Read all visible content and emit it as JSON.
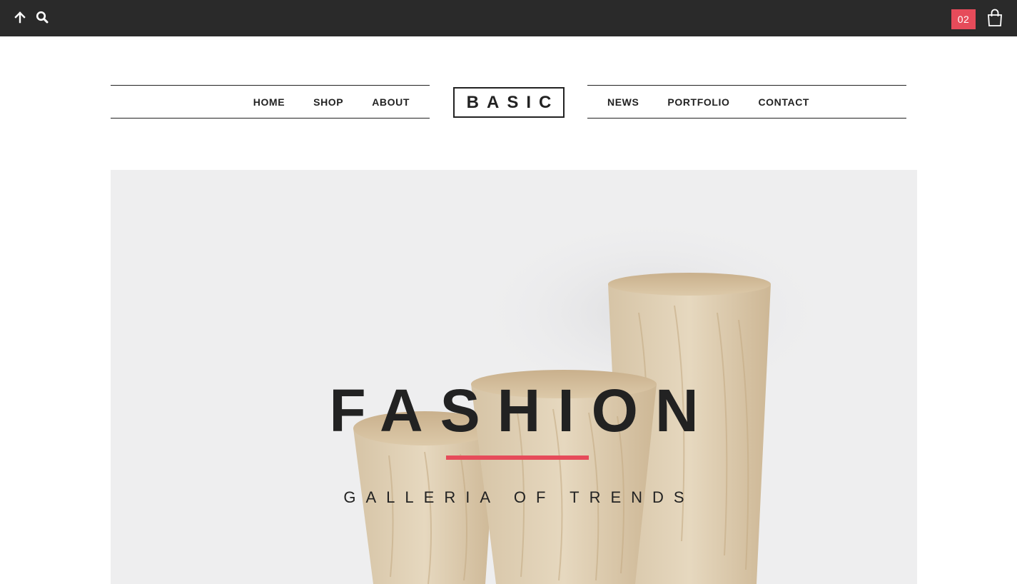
{
  "topbar": {
    "cart_count": "02",
    "icons": [
      "arrow-up-icon",
      "search-icon",
      "shopping-bag-icon"
    ],
    "background": "#2a2a2a",
    "accent": "#e64b5a"
  },
  "header": {
    "logo": "BASIC",
    "nav_left": [
      {
        "label": "HOME"
      },
      {
        "label": "SHOP"
      },
      {
        "label": "ABOUT"
      }
    ],
    "nav_right": [
      {
        "label": "NEWS"
      },
      {
        "label": "PORTFOLIO"
      },
      {
        "label": "CONTACT"
      }
    ]
  },
  "hero": {
    "title": "FASHION",
    "subtitle": "GALLERIA OF TRENDS",
    "background": "#eeeeef"
  }
}
